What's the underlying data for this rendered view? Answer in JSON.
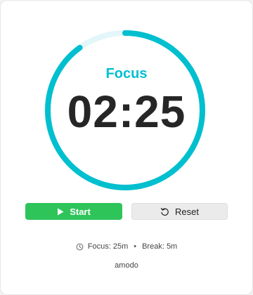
{
  "theme": {
    "accent": "#00bfcf",
    "track": "#e3f6f9",
    "start_button": "#2ec45a",
    "progress": 0.9
  },
  "timer": {
    "mode": "Focus",
    "time": "02:25"
  },
  "controls": {
    "start_label": "Start",
    "start_icon": "play-icon",
    "reset_label": "Reset",
    "reset_icon": "reset-icon"
  },
  "settings": {
    "icon": "clock-icon",
    "focus": "Focus: 25m",
    "separator": "•",
    "break": "Break: 5m"
  },
  "brand": "amodo"
}
